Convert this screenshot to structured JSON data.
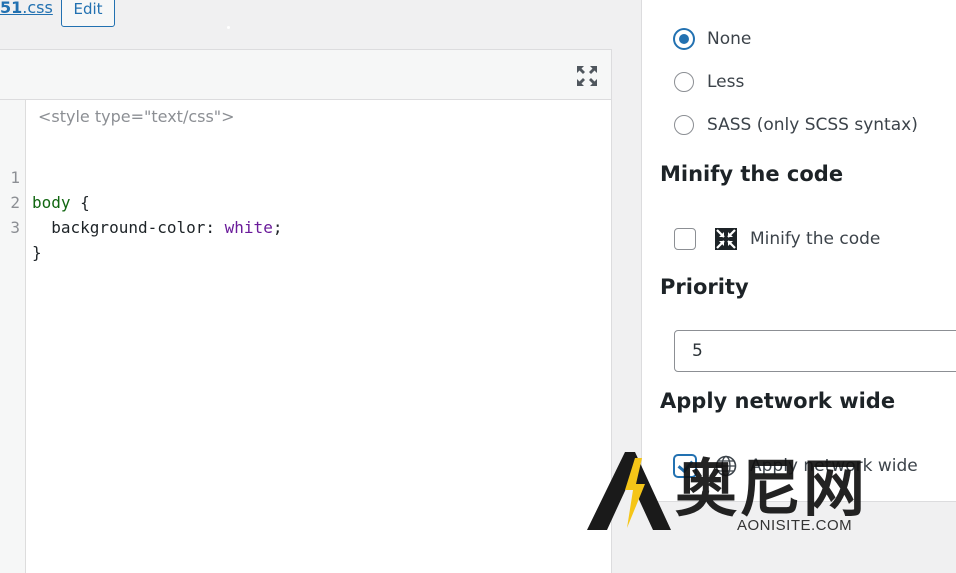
{
  "file": {
    "link_partial": "51",
    "link_ext": ".css",
    "edit_label": "Edit"
  },
  "editor": {
    "open_tag": "<style type=\"text/css\">",
    "lines": [
      {
        "number": "1",
        "selector": "body",
        "rest": " {"
      },
      {
        "number": "2",
        "property": "  background-color: ",
        "value": "white",
        "end": ";"
      },
      {
        "number": "3",
        "text": "}"
      }
    ],
    "fullscreen_icon": "expand-icon"
  },
  "settings": {
    "preprocessor_options": [
      {
        "label": "None",
        "checked": true
      },
      {
        "label": "Less",
        "checked": false
      },
      {
        "label": "SASS (only SCSS syntax)",
        "checked": false
      }
    ],
    "minify": {
      "title": "Minify the code",
      "label": "Minify the code",
      "checked": false,
      "icon": "compress-icon"
    },
    "priority": {
      "title": "Priority",
      "value": "5"
    },
    "network": {
      "title": "Apply network wide",
      "label": "Apply network wide",
      "checked": true,
      "icon": "globe-icon"
    }
  },
  "watermark": {
    "chinese": "奥尼网",
    "url": "AONISITE.COM"
  },
  "colors": {
    "accent": "#2271b1",
    "selector": "#116611",
    "value": "#6a1b9a"
  }
}
